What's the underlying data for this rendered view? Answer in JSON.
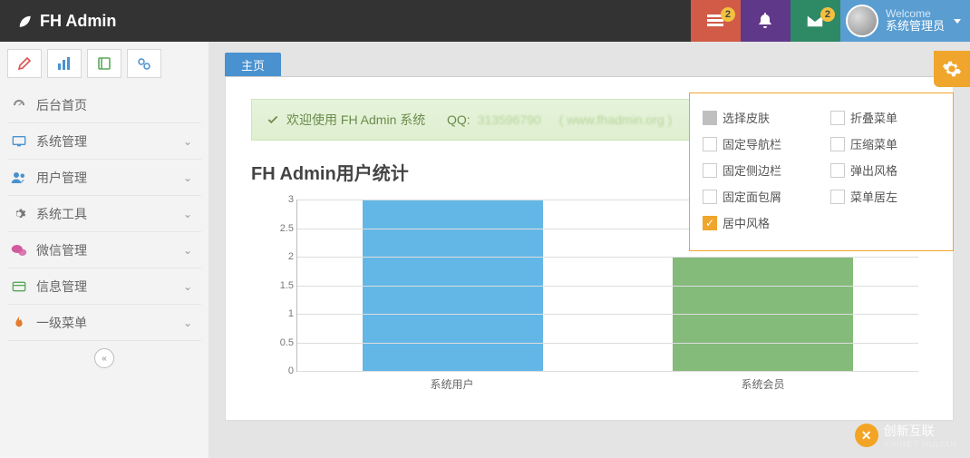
{
  "brand": "FH Admin",
  "topbar": {
    "badge1": "2",
    "badge2": "2",
    "welcome": "Welcome",
    "role": "系统管理员"
  },
  "sidebar": {
    "items": [
      {
        "label": "后台首页",
        "icon": "dashboard",
        "color": "#888",
        "expandable": false
      },
      {
        "label": "系统管理",
        "icon": "desktop",
        "color": "#4a91d0",
        "expandable": true
      },
      {
        "label": "用户管理",
        "icon": "users",
        "color": "#4a91d0",
        "expandable": true
      },
      {
        "label": "系统工具",
        "icon": "gear",
        "color": "#777",
        "expandable": true
      },
      {
        "label": "微信管理",
        "icon": "wechat",
        "color": "#d15b9d",
        "expandable": true
      },
      {
        "label": "信息管理",
        "icon": "card",
        "color": "#5aa85a",
        "expandable": true
      },
      {
        "label": "一级菜单",
        "icon": "flame",
        "color": "#e47b2c",
        "expandable": true
      }
    ]
  },
  "tabs": {
    "main": "主页"
  },
  "welcome_band": {
    "prefix": "欢迎使用 FH Admin 系统",
    "qq_label": "QQ:",
    "qq_blur": "313596790",
    "site_blur": "( www.fhadmin.org )"
  },
  "settings": {
    "options": [
      {
        "label": "选择皮肤",
        "state": "gray"
      },
      {
        "label": "折叠菜单",
        "state": "off"
      },
      {
        "label": "固定导航栏",
        "state": "off"
      },
      {
        "label": "压缩菜单",
        "state": "off"
      },
      {
        "label": "固定侧边栏",
        "state": "off"
      },
      {
        "label": "弹出风格",
        "state": "off"
      },
      {
        "label": "固定面包屑",
        "state": "off"
      },
      {
        "label": "菜单居左",
        "state": "off"
      },
      {
        "label": "居中风格",
        "state": "checked"
      }
    ]
  },
  "chart_data": {
    "type": "bar",
    "title": "FH Admin用户统计",
    "categories": [
      "系统用户",
      "系统会员"
    ],
    "values": [
      3,
      2
    ],
    "ylim": [
      0,
      3
    ],
    "ystep": 0.5,
    "colors": [
      "#63b7e6",
      "#84bb7b"
    ]
  },
  "watermark": {
    "brand": "创新互联",
    "sub": "XINNET HULIAN"
  }
}
